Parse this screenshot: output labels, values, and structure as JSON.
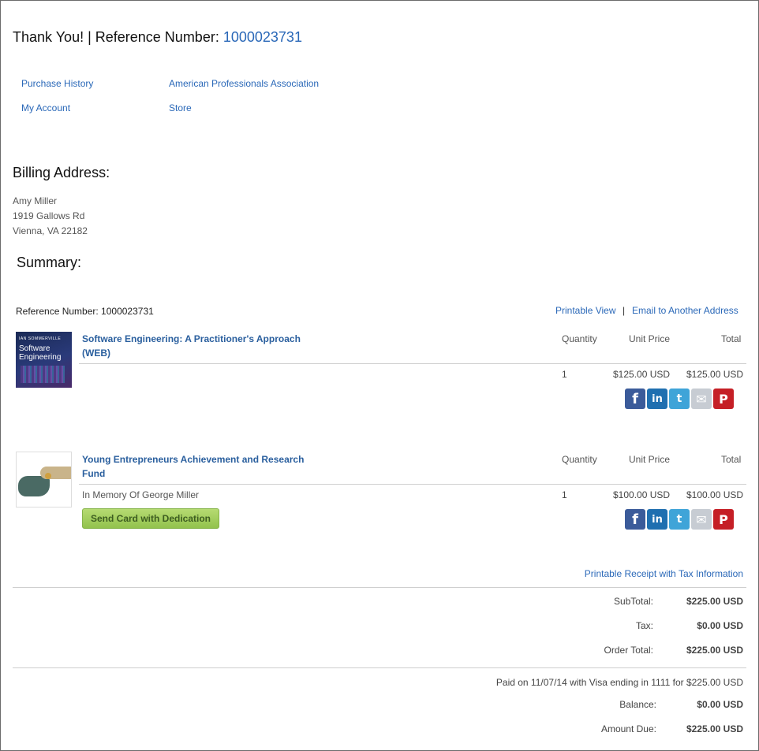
{
  "header": {
    "thank_you": "Thank You! | Reference Number:",
    "reference": "1000023731"
  },
  "nav": {
    "purchase_history": "Purchase History",
    "association": "American Professionals Association",
    "my_account": "My Account",
    "store": "Store"
  },
  "billing": {
    "heading": "Billing Address:",
    "name": "Amy Miller",
    "street": "1919 Gallows Rd",
    "city": "Vienna, VA 22182"
  },
  "summary": {
    "heading": "Summary:",
    "reference_label": "Reference Number: 1000023731",
    "printable_view": "Printable View",
    "separator": "|",
    "email_link": "Email to Another Address"
  },
  "columns": {
    "quantity": "Quantity",
    "unit_price": "Unit Price",
    "total": "Total"
  },
  "items": [
    {
      "image_text": {
        "author": "IAN SOMMERVILLE",
        "title": "Software Engineering"
      },
      "title": "Software Engineering: A Practitioner's Approach (WEB)",
      "note": "",
      "quantity": "1",
      "unit_price": "$125.00 USD",
      "total": "$125.00 USD"
    },
    {
      "title": "Young Entrepreneurs Achievement and Research Fund",
      "note": "In Memory Of George Miller",
      "button": "Send Card with Dedication",
      "quantity": "1",
      "unit_price": "$100.00 USD",
      "total": "$100.00 USD"
    }
  ],
  "share_icons": [
    "facebook-icon",
    "linkedin-icon",
    "twitter-icon",
    "email-icon",
    "pinterest-icon"
  ],
  "totals": {
    "receipt_link": "Printable Receipt with Tax Information",
    "subtotal_label": "SubTotal:",
    "subtotal": "$225.00 USD",
    "tax_label": "Tax:",
    "tax": "$0.00 USD",
    "order_total_label": "Order Total:",
    "order_total": "$225.00 USD",
    "paid_note": "Paid on 11/07/14 with Visa ending in 1111 for $225.00 USD",
    "balance_label": "Balance:",
    "balance": "$0.00 USD",
    "amount_due_label": "Amount Due:",
    "amount_due": "$225.00 USD"
  },
  "colors": {
    "link": "#2a68b8",
    "button_green": "#92c24d"
  }
}
